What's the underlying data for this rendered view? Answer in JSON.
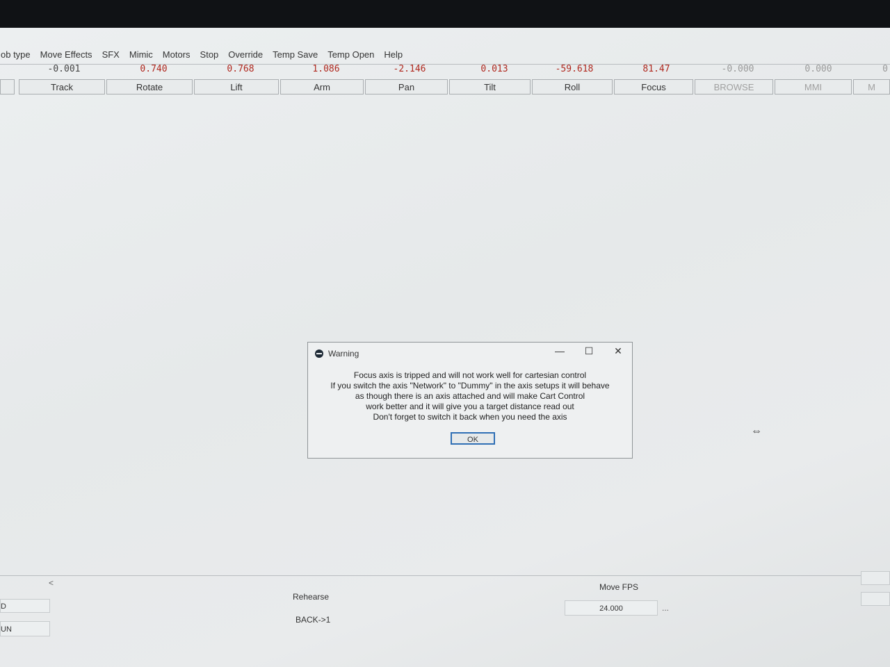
{
  "menu": [
    "ob type",
    "Move Effects",
    "SFX",
    "Mimic",
    "Motors",
    "Stop",
    "Override",
    "Temp Save",
    "Temp Open",
    "Help"
  ],
  "axes": [
    {
      "value": "-0.001",
      "label": "Track"
    },
    {
      "value": "0.740",
      "label": "Rotate"
    },
    {
      "value": "0.768",
      "label": "Lift"
    },
    {
      "value": "1.086",
      "label": "Arm"
    },
    {
      "value": "-2.146",
      "label": "Pan"
    },
    {
      "value": "0.013",
      "label": "Tilt"
    },
    {
      "value": "-59.618",
      "label": "Roll"
    },
    {
      "value": "81.47",
      "label": "Focus"
    },
    {
      "value": "-0.000",
      "label": "BROWSE"
    },
    {
      "value": "0.000",
      "label": "MMI"
    },
    {
      "value": "0",
      "label": "M"
    }
  ],
  "dialog": {
    "title": "Warning",
    "minimize": "—",
    "maximize": "☐",
    "close": "✕",
    "lines": [
      "Focus axis is tripped and will not work well for cartesian control",
      "If you switch the axis \"Network\" to \"Dummy\" in the axis setups it will behave",
      "as though there is an axis attached and will make Cart Control",
      "work better and it will give you a target distance read out",
      "Don't forget to switch it back when you need the axis"
    ],
    "ok_label": "OK"
  },
  "bottom": {
    "collapse_glyph": "<",
    "left_label_1": "D",
    "left_label_2": "UN",
    "rehearse": "Rehearse",
    "back": "BACK->1",
    "move_fps_label": "Move FPS",
    "move_fps_value": "24.000",
    "ellipsis": "..."
  },
  "cursor_glyph": "⇔"
}
